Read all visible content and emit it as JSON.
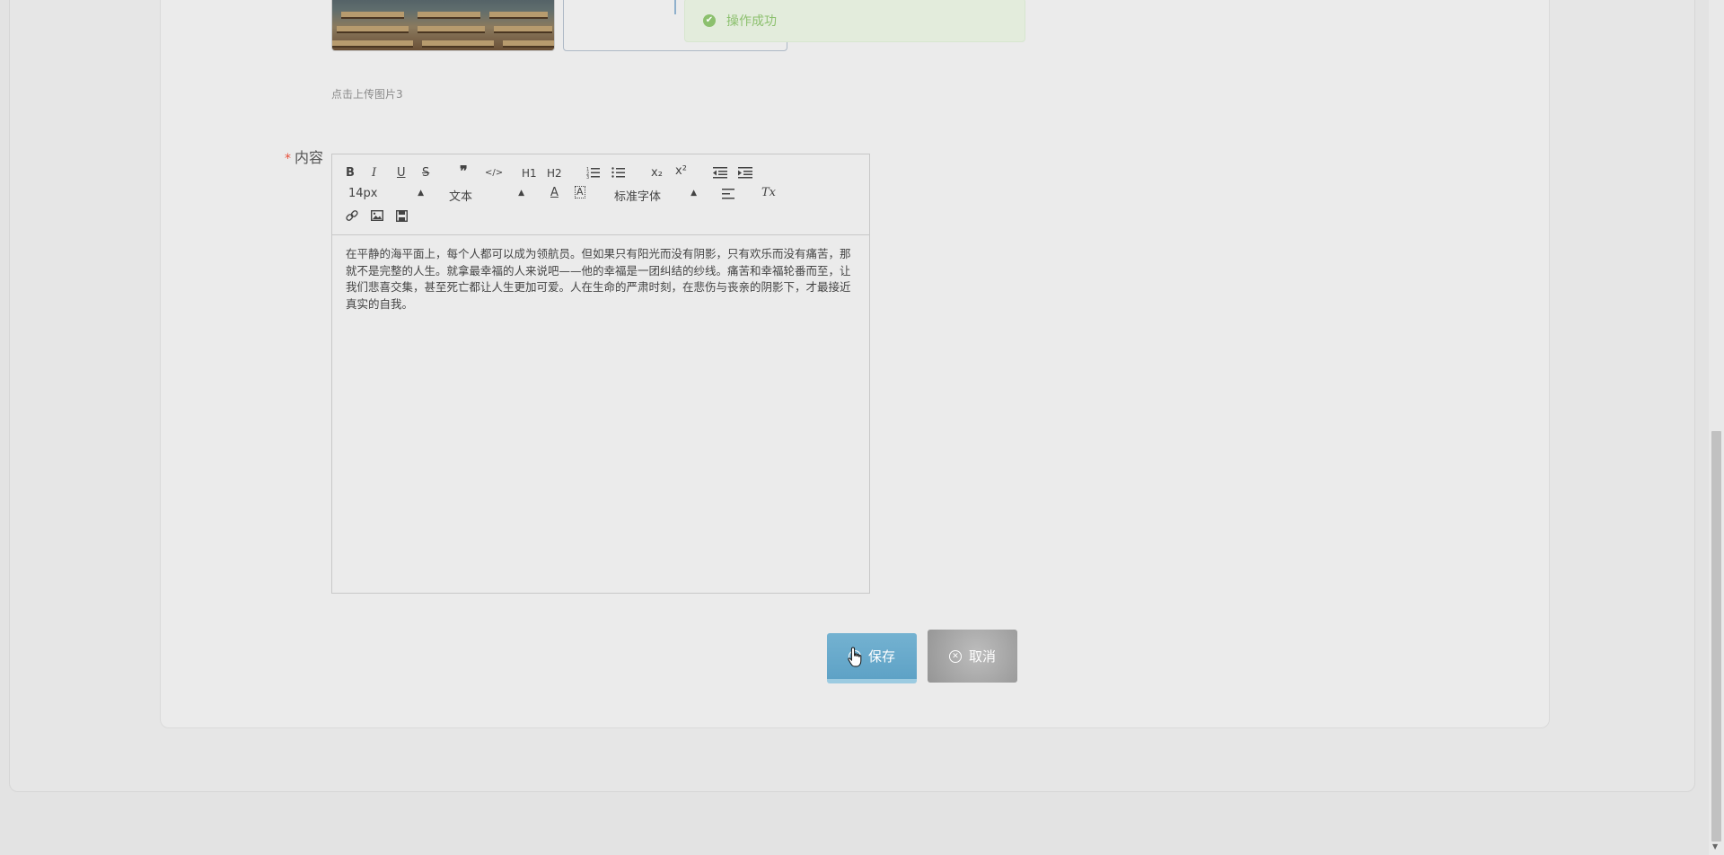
{
  "toast": {
    "message": "操作成功",
    "icon": "check-circle-icon"
  },
  "upload": {
    "hint": "点击上传图片3"
  },
  "content_field": {
    "required_mark": "*",
    "label": "内容"
  },
  "editor": {
    "toolbar": {
      "bold": "B",
      "italic": "I",
      "underline": "U",
      "strike": "S",
      "blockquote": "❞",
      "code": "</>",
      "h1": "H1",
      "h2": "H2",
      "subscript": "x₂",
      "superscript": "x²",
      "size_value": "14px",
      "header_value": "文本",
      "font_value": "标准字体",
      "color": "A",
      "background": "A",
      "clean": "Tx"
    },
    "content": "在平静的海平面上，每个人都可以成为领航员。但如果只有阳光而没有阴影，只有欢乐而没有痛苦，那就不是完整的人生。就拿最幸福的人来说吧——他的幸福是一团纠结的纱线。痛苦和幸福轮番而至，让我们悲喜交集，甚至死亡都让人生更加可爱。人在生命的严肃时刻，在悲伤与丧亲的阴影下，才最接近真实的自我。"
  },
  "buttons": {
    "save": "保存",
    "cancel": "取消"
  },
  "colors": {
    "save_bg": "#5ea2c6",
    "cancel_bg": "#9e9e9e",
    "toast_text": "#8cc06e",
    "required": "#e8503a"
  }
}
